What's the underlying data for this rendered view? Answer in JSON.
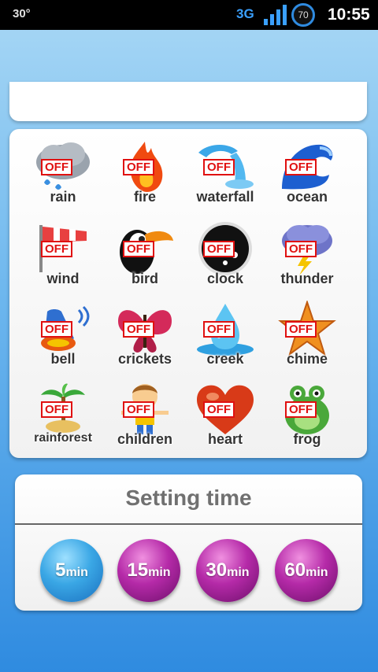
{
  "status_bar": {
    "temperature": "30°",
    "network": "3G",
    "battery": "70",
    "time": "10:55"
  },
  "sounds": [
    {
      "label": "rain",
      "state": "OFF",
      "icon": "rain-cloud-icon"
    },
    {
      "label": "fire",
      "state": "OFF",
      "icon": "fire-icon"
    },
    {
      "label": "waterfall",
      "state": "OFF",
      "icon": "waterfall-icon"
    },
    {
      "label": "ocean",
      "state": "OFF",
      "icon": "ocean-wave-icon"
    },
    {
      "label": "wind",
      "state": "OFF",
      "icon": "windsock-icon"
    },
    {
      "label": "bird",
      "state": "OFF",
      "icon": "toucan-icon"
    },
    {
      "label": "clock",
      "state": "OFF",
      "icon": "clock-icon"
    },
    {
      "label": "thunder",
      "state": "OFF",
      "icon": "thunder-cloud-icon"
    },
    {
      "label": "bell",
      "state": "OFF",
      "icon": "bell-icon"
    },
    {
      "label": "crickets",
      "state": "OFF",
      "icon": "butterfly-icon"
    },
    {
      "label": "creek",
      "state": "OFF",
      "icon": "water-drop-icon"
    },
    {
      "label": "chime",
      "state": "OFF",
      "icon": "starfish-icon"
    },
    {
      "label": "rainforest",
      "state": "OFF",
      "icon": "palm-island-icon"
    },
    {
      "label": "children",
      "state": "OFF",
      "icon": "child-icon"
    },
    {
      "label": "heart",
      "state": "OFF",
      "icon": "heart-icon"
    },
    {
      "label": "frog",
      "state": "OFF",
      "icon": "frog-icon"
    }
  ],
  "setting": {
    "title": "Setting time",
    "options": [
      {
        "num": "5",
        "unit": "min",
        "selected": true
      },
      {
        "num": "15",
        "unit": "min",
        "selected": false
      },
      {
        "num": "30",
        "unit": "min",
        "selected": false
      },
      {
        "num": "60",
        "unit": "min",
        "selected": false
      }
    ]
  },
  "colors": {
    "off_badge": "#e01010",
    "selected_button": "#3aa7e5",
    "time_button": "#b52aa8"
  }
}
